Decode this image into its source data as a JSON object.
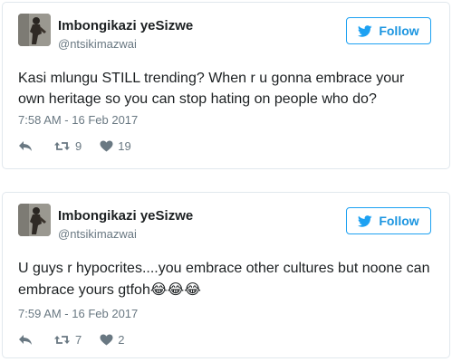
{
  "tweets": [
    {
      "display_name": "Imbongikazi yeSizwe",
      "handle": "@ntsikimazwai",
      "follow_label": "Follow",
      "text": "Kasi mlungu STILL trending? When r u gonna embrace your own heritage so you can stop hating on people who do?",
      "emoji": "",
      "timestamp": "7:58 AM - 16 Feb 2017",
      "retweets": "9",
      "likes": "19"
    },
    {
      "display_name": "Imbongikazi yeSizwe",
      "handle": "@ntsikimazwai",
      "follow_label": "Follow",
      "text": "U guys r hypocrites....you embrace other cultures but noone can embrace yours gtfoh",
      "emoji": "😂😂😂",
      "timestamp": "7:59 AM - 16 Feb 2017",
      "retweets": "7",
      "likes": "2"
    }
  ],
  "colors": {
    "accent": "#1da1f2",
    "follow_text": "#1b95e0",
    "muted": "#697882",
    "text": "#1c2022",
    "border": "#e1e8ed"
  },
  "icons": {
    "follow": "twitter-bird-icon",
    "reply": "reply-icon",
    "retweet": "retweet-icon",
    "like": "heart-icon"
  }
}
